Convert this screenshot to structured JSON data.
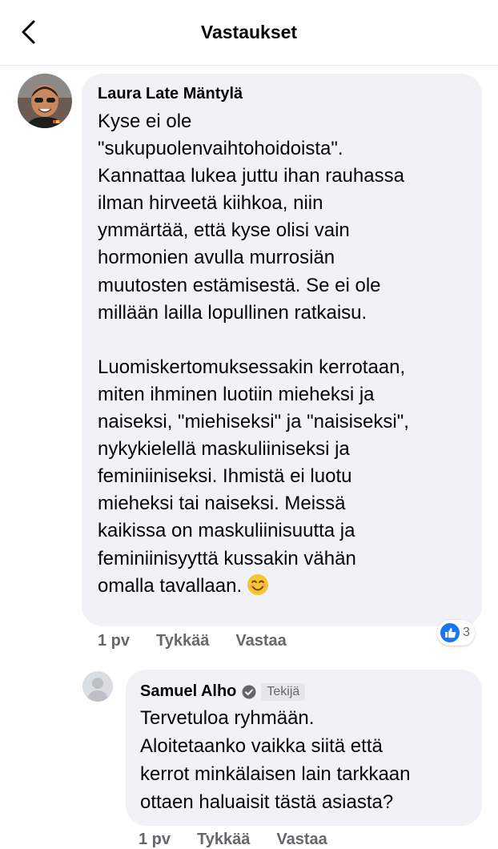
{
  "header": {
    "title": "Vastaukset"
  },
  "comments": [
    {
      "author": "Laura Late Mäntylä",
      "text": "Kyse ei ole\n\"sukupuolenvaihtohoidoista\".\nKannattaa lukea juttu ihan rauhassa\nilman hirveetä kiihkoa, niin\nymmärtää, että kyse olisi vain\nhormonien avulla murrosiän\nmuutosten estämisestä. Se ei ole\nmillään lailla lopullinen ratkaisu.\n\nLuomiskertomuksessakin kerrotaan,\nmiten ihminen luotiin mieheksi ja\nnaiseksi, \"miehiseksi\" ja \"naisiseksi\",\nnykykielellä maskuliiniseksi ja\nfeminiiniseksi. Ihmistä ei luotu\nmieheksi tai naiseksi. Meissä\nkaikissa on maskuliinisuutta ja\nfeminiinisyyttä kussakin vähän\nomalla tavallaan.",
      "time": "1 pv",
      "like_label": "Tykkää",
      "reply_label": "Vastaa",
      "reaction_count": "3"
    },
    {
      "author": "Samuel Alho",
      "badge": "Tekijä",
      "text": "Tervetuloa ryhmään.\nAloitetaanko vaikka siitä että\nkerrot minkälaisen lain tarkkaan\nottaen haluaisit tästä asiasta?",
      "time": "1 pv",
      "like_label": "Tykkää",
      "reply_label": "Vastaa"
    }
  ],
  "colors": {
    "bubble": "#f0f2f5",
    "meta_text": "#65676b",
    "like_blue": "#1877f2"
  },
  "icons": {
    "back": "chevron-left-icon",
    "verified": "verified-check-icon",
    "like": "thumbs-up-icon",
    "emoji": "smiling-face-icon"
  }
}
